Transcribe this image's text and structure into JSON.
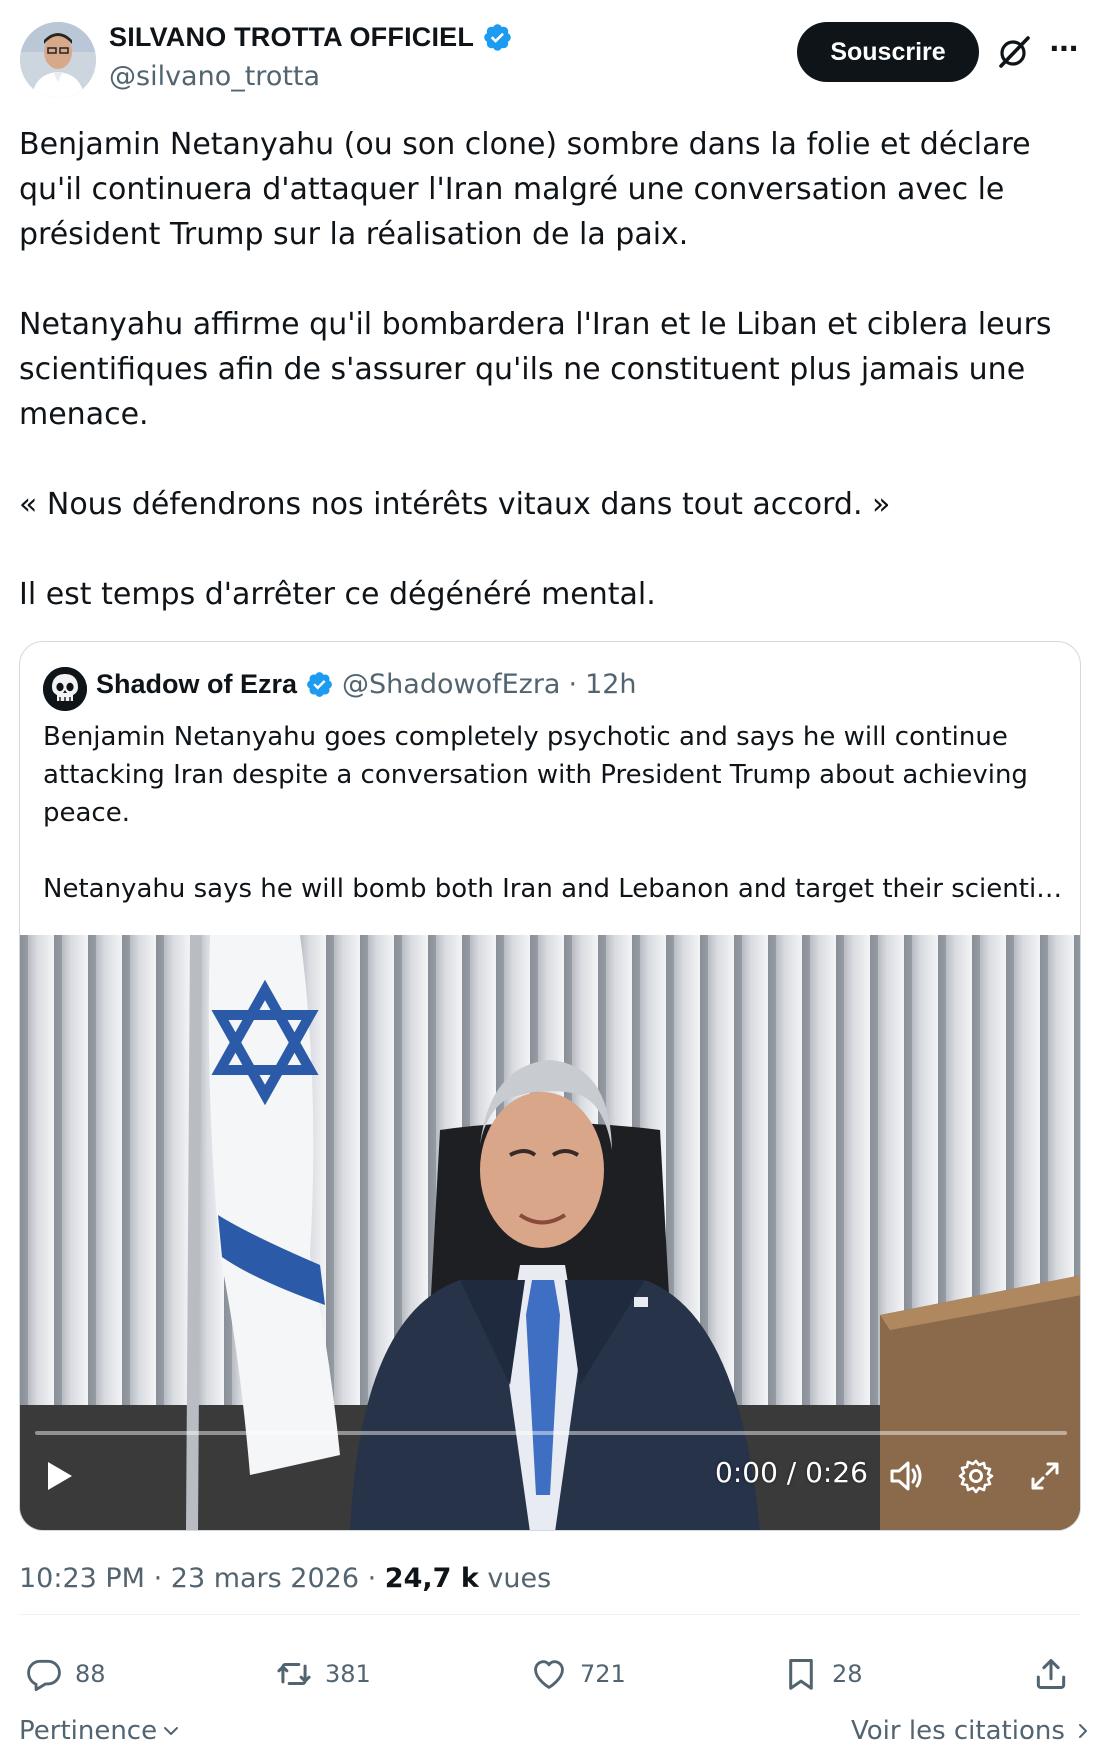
{
  "author": {
    "name": "SILVANO TROTTA OFFICIEL",
    "handle": "@silvano_trotta",
    "verified_color": "#1d9bf0"
  },
  "header": {
    "subscribe_label": "Souscrire",
    "icons": [
      "grok-icon",
      "more-icon"
    ]
  },
  "post": {
    "paragraphs": [
      "Benjamin Netanyahu (ou son clone) sombre dans la folie et déclare qu'il continuera d'attaquer l'Iran malgré une conversation avec le président Trump sur la réalisation de la paix.",
      "Netanyahu affirme qu'il bombardera l'Iran et le Liban et ciblera leurs scientifiques afin de s'assurer qu'ils ne constituent plus jamais une menace.",
      "« Nous défendrons nos intérêts vitaux dans tout accord. »",
      "Il est temps d'arrêter ce dégénéré mental."
    ]
  },
  "quote": {
    "name": "Shadow of Ezra",
    "handle": "@ShadowofEzra",
    "separator": "·",
    "time": "12h",
    "paragraphs": [
      "Benjamin Netanyahu goes completely psychotic and says he will continue attacking Iran despite a conversation with President Trump about achieving peace.",
      "Netanyahu says he will bomb both Iran and Lebanon and target their scientist..."
    ],
    "video": {
      "time_label": "0:00 / 0:26",
      "progress": 0
    }
  },
  "meta": {
    "time": "10:23 PM",
    "date": "23 mars 2026",
    "views_count": "24,7 k",
    "views_label": "vues",
    "separator": "·"
  },
  "actions": {
    "replies": "88",
    "reposts": "381",
    "likes": "721",
    "bookmarks": "28"
  },
  "footer": {
    "sort_label": "Pertinence",
    "quotes_label": "Voir les citations"
  }
}
